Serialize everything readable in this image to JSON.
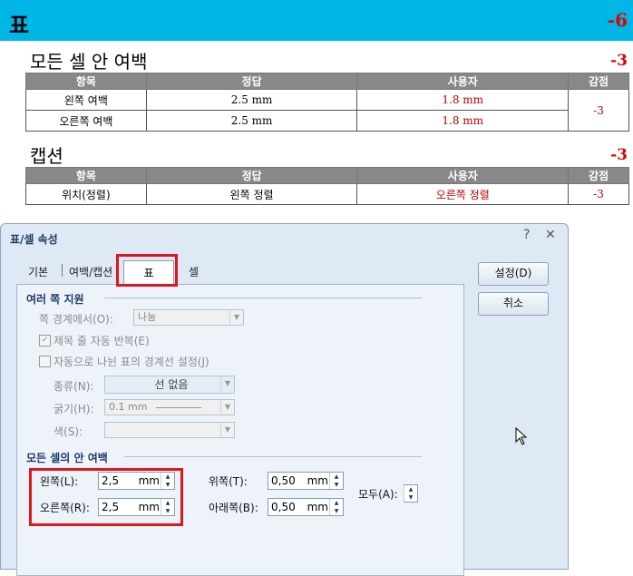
{
  "header": {
    "title": "표",
    "score": "-6"
  },
  "section1": {
    "title": "모든 셀 안 여백",
    "score": "-3",
    "columns": [
      "항목",
      "정답",
      "사용자",
      "감점"
    ],
    "rows": [
      {
        "item": "왼쪽 여백",
        "answer": "2.5 mm",
        "user": "1.8 mm"
      },
      {
        "item": "오른쪽 여백",
        "answer": "2.5 mm",
        "user": "1.8 mm"
      }
    ],
    "deduction": "-3"
  },
  "section2": {
    "title": "캡션",
    "score": "-3",
    "columns": [
      "항목",
      "정답",
      "사용자",
      "감점"
    ],
    "rows": [
      {
        "item": "위치(정렬)",
        "answer": "왼쪽 정렬",
        "user": "오른쪽 정렬",
        "deduction": "-3"
      }
    ]
  },
  "dialog": {
    "title": "표/셀 속성",
    "help_icon": "?",
    "close_icon": "✕",
    "tabs": [
      "기본",
      "여백/캡션",
      "표",
      "셀"
    ],
    "ok_label": "설정(D)",
    "cancel_label": "취소",
    "multi_page": {
      "group_label": "여러 쪽 지원",
      "boundary_label": "쪽 경계에서(O):",
      "boundary_value": "나눔",
      "repeat_header_label": "제목 줄 자동 반복(E)",
      "auto_border_label": "자동으로 나뉜 표의 경계선 설정(J)",
      "type_label": "종류(N):",
      "type_value": "선 없음",
      "thickness_label": "굵기(H):",
      "thickness_value": "0.1 mm",
      "color_label": "색(S):"
    },
    "cell_margin": {
      "group_label": "모든 셀의 안 여백",
      "left_label": "왼쪽(L):",
      "left_value": "2,5",
      "right_label": "오른쪽(R):",
      "right_value": "2,5",
      "top_label": "위쪽(T):",
      "top_value": "0,50",
      "bottom_label": "아래쪽(B):",
      "bottom_value": "0,50",
      "all_label": "모두(A):",
      "unit": "mm"
    }
  },
  "colors": {
    "header_bg": "#00b6e6",
    "deduction": "#e00000",
    "highlight": "#e0161e"
  }
}
